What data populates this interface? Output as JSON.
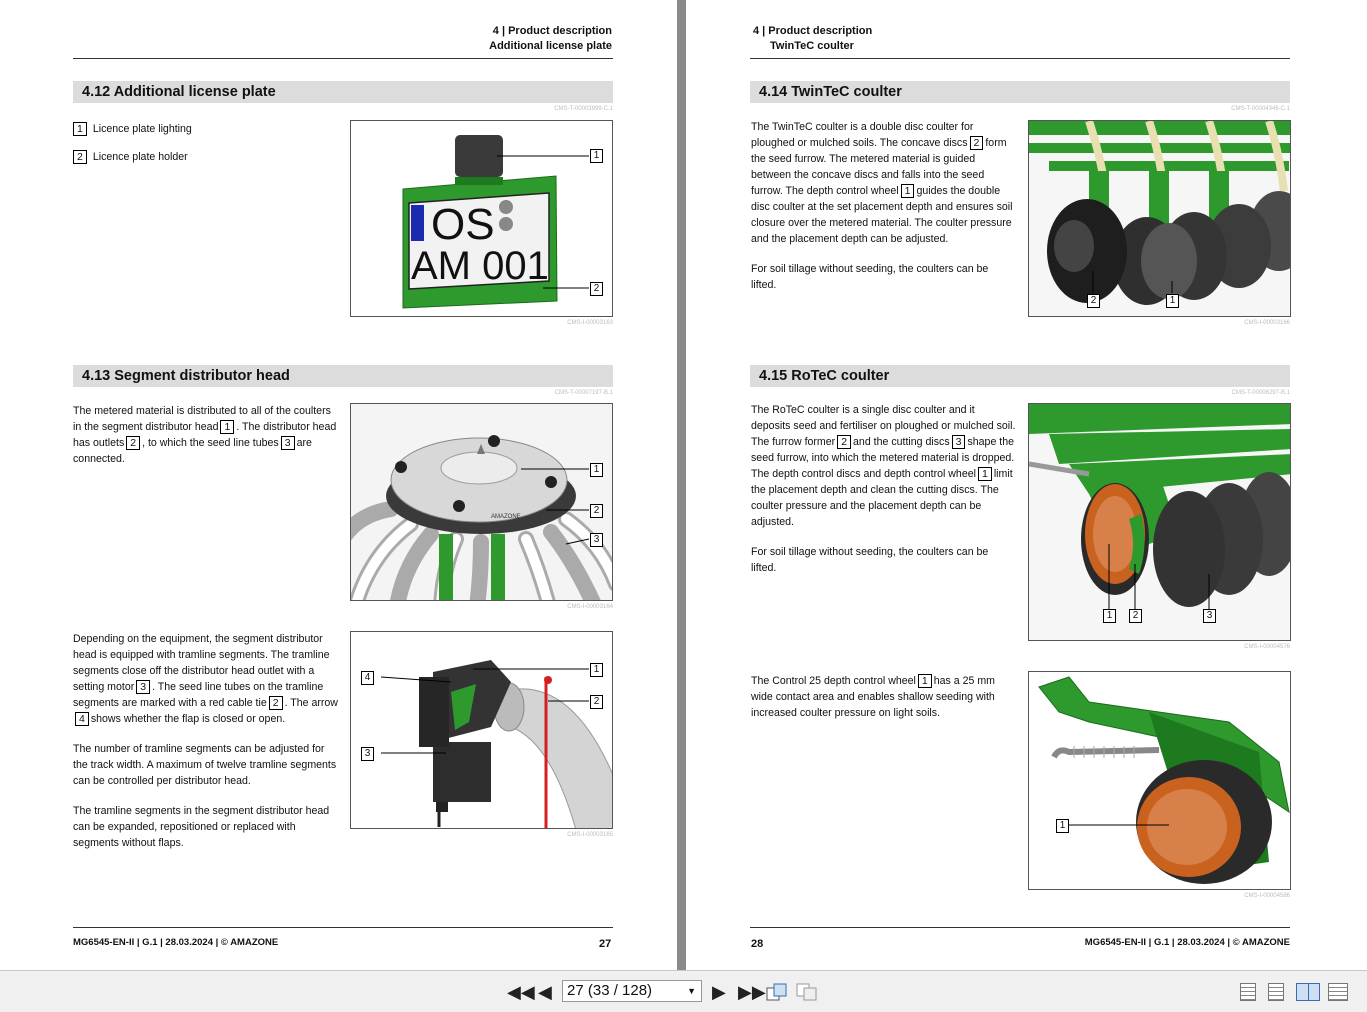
{
  "left_page": {
    "header_line1": "4 | Product description",
    "header_line2": "Additional license plate",
    "sec_412": {
      "title": "4.12  Additional license plate",
      "cms_top": "CMS-T-00003999-C.1",
      "legend": [
        {
          "num": "1",
          "label": "Licence plate lighting"
        },
        {
          "num": "2",
          "label": "Licence plate holder"
        }
      ],
      "plate_line1": "OS",
      "plate_line2": "AM 001",
      "callouts": [
        "1",
        "2"
      ],
      "cms_fig": "CMS-I-00003163"
    },
    "sec_413": {
      "title": "4.13  Segment distributor head",
      "cms_top": "CMS-T-00007197-B.1",
      "p1_a": "The metered material is distributed to all of the coulters in the segment distributor head",
      "p1_n1": "1",
      "p1_b": ". The distributor head has outlets",
      "p1_n2": "2",
      "p1_c": ", to which the seed line tubes",
      "p1_n3": "3",
      "p1_d": "are connected.",
      "fig1_callouts": [
        "1",
        "2",
        "3"
      ],
      "fig1_brand": "AMAZONE",
      "cms_fig1": "CMS-I-00003164",
      "p2_a": "Depending on the equipment, the segment distributor head is equipped with tramline segments. The tramline segments close off the distributor head outlet with a setting motor",
      "p2_n1": "3",
      "p2_b": ". The seed line tubes on the tramline segments are marked with a red cable tie",
      "p2_n2": "2",
      "p2_c": ". The arrow",
      "p2_n3": "4",
      "p2_d": "shows whether the flap is closed or open.",
      "p3": "The number of tramline segments can be adjusted for the track width. A maximum of twelve tramline segments can be controlled per distributor head.",
      "p4": "The tramline segments in the segment distributor head can be expanded, repositioned or replaced with segments without flaps.",
      "fig2_callouts": [
        "1",
        "2",
        "3",
        "4"
      ],
      "cms_fig2": "CMS-I-00003165"
    },
    "footer": "MG6545-EN-II | G.1 | 28.03.2024 | © AMAZONE",
    "page_number": "27"
  },
  "right_page": {
    "header_line1": "4 | Product description",
    "header_line2": "TwinTeC coulter",
    "sec_414": {
      "title": "4.14  TwinTeC coulter",
      "cms_top": "CMS-T-00004346-C.1",
      "p1_a": "The TwinTeC coulter is a double disc coulter for ploughed or mulched soils. The concave discs",
      "p1_n1": "2",
      "p1_b": "form the seed furrow. The metered material is guided between the concave discs and falls into the seed furrow. The depth control wheel",
      "p1_n2": "1",
      "p1_c": "guides the double disc coulter at the set placement depth and ensures soil closure over the metered material. The coulter pressure and the placement depth can be adjusted.",
      "p2": "For soil tillage without seeding, the coulters can be lifted.",
      "callouts": [
        "2",
        "1"
      ],
      "cms_fig": "CMS-I-00003166"
    },
    "sec_415": {
      "title": "4.15  RoTeC coulter",
      "cms_top": "CMS-T-00006297-B.1",
      "p1_a": "The RoTeC coulter is a single disc coulter and it deposits seed and fertiliser on ploughed or mulched soil. The furrow former",
      "p1_n1": "2",
      "p1_b": "and the cutting discs",
      "p1_n2": "3",
      "p1_c": "shape the seed furrow, into which the metered material is dropped. The depth control discs and depth control wheel",
      "p1_n3": "1",
      "p1_d": "limit the placement depth and clean the cutting discs. The coulter pressure and the placement depth can be adjusted.",
      "p2": "For soil tillage without seeding, the coulters can be lifted.",
      "callouts": [
        "1",
        "2",
        "3"
      ],
      "cms_fig1": "CMS-I-00004576",
      "p3_a": "The Control 25 depth control wheel",
      "p3_n1": "1",
      "p3_b": "has a 25 mm wide contact area and enables shallow seeding with increased coulter pressure on light soils.",
      "fig2_callouts": [
        "1"
      ],
      "cms_fig2": "CMS-I-00004586"
    },
    "footer": "MG6545-EN-II | G.1 | 28.03.2024 | © AMAZONE",
    "page_number": "28"
  },
  "toolbar": {
    "page_indicator": "27 (33 / 128)",
    "icons": [
      "first-page-icon",
      "prev-page-icon",
      "next-page-icon",
      "last-page-icon",
      "previous-view-icon",
      "next-view-icon",
      "single-page-view-icon",
      "continuous-view-icon",
      "two-page-view-icon",
      "two-page-continuous-view-icon"
    ]
  },
  "colors": {
    "machine_green": "#2e9a2e",
    "section_bar": "#dcdcdc",
    "plate_blue": "#1a2bb0",
    "disc_orange": "#c8621e"
  }
}
